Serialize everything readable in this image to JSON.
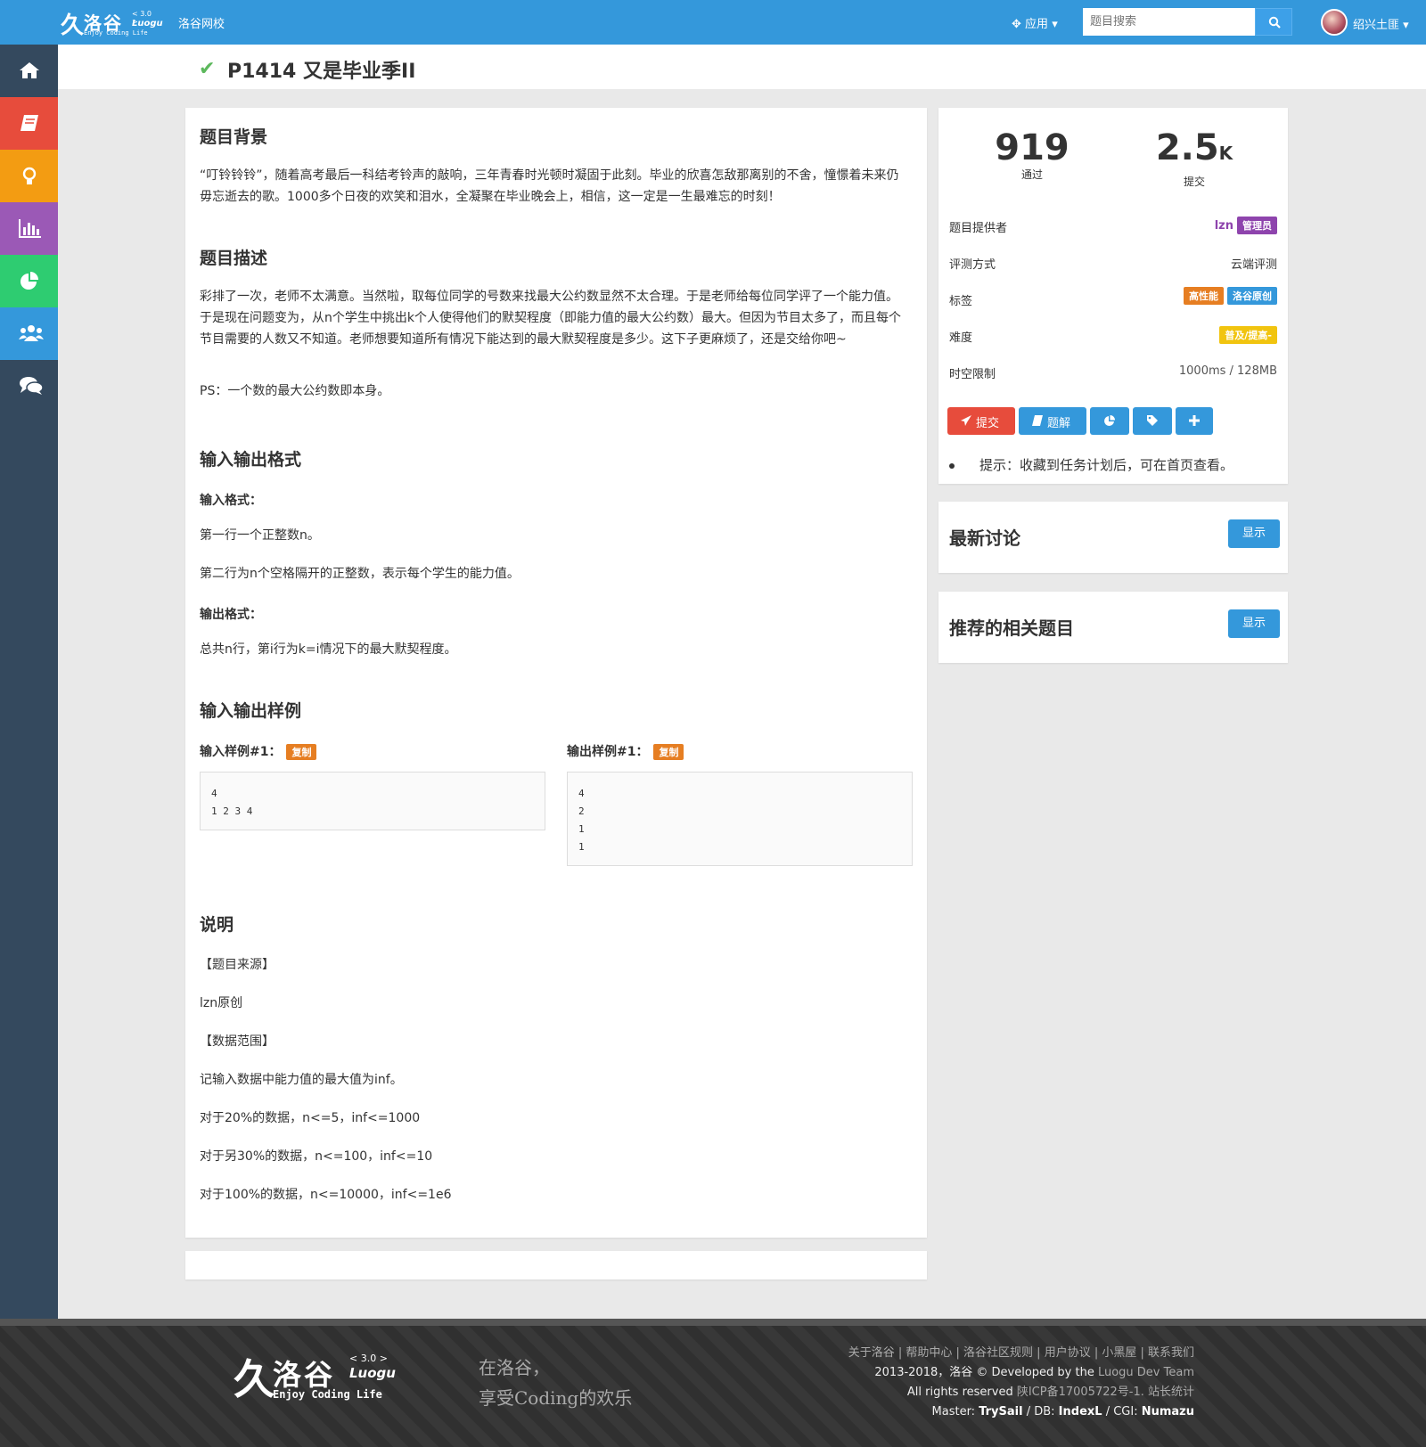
{
  "header": {
    "logo": {
      "name": "洛谷",
      "version": "< 3.0 >",
      "sub": "Luogu",
      "tagline": "Enjoy Coding Life"
    },
    "school_link": "洛谷网校",
    "apps_label": "应用",
    "search_placeholder": "题目搜索",
    "user_name": "绍兴土匪"
  },
  "sidebar": {
    "items": [
      {
        "icon": "home-icon",
        "color": "#34495e"
      },
      {
        "icon": "book-icon",
        "color": "#e74c3c"
      },
      {
        "icon": "lightbulb-icon",
        "color": "#f39c12"
      },
      {
        "icon": "bar-chart-icon",
        "color": "#9b59b6"
      },
      {
        "icon": "pie-chart-icon",
        "color": "#2ecc71"
      },
      {
        "icon": "users-icon",
        "color": "#3498db"
      },
      {
        "icon": "comments-icon",
        "color": "#34495e"
      }
    ]
  },
  "problem": {
    "title": "P1414 又是毕业季II",
    "background_h": "题目背景",
    "background_p": "“叮铃铃铃”，随着高考最后一科结考铃声的敲响，三年青春时光顿时凝固于此刻。毕业的欣喜怎敌那离别的不舍，憧憬着未来仍毋忘逝去的歌。1000多个日夜的欢笑和泪水，全凝聚在毕业晚会上，相信，这一定是一生最难忘的时刻！",
    "desc_h": "题目描述",
    "desc_p1": "彩排了一次，老师不太满意。当然啦，取每位同学的号数来找最大公约数显然不太合理。于是老师给每位同学评了一个能力值。于是现在问题变为，从n个学生中挑出k个人使得他们的默契程度（即能力值的最大公约数）最大。但因为节目太多了，而且每个节目需要的人数又不知道。老师想要知道所有情况下能达到的最大默契程度是多少。这下子更麻烦了，还是交给你吧~",
    "desc_p2": "PS：一个数的最大公约数即本身。",
    "io_h": "输入输出格式",
    "input_fmt_h": "输入格式：",
    "input_fmt_1": "第一行一个正整数n。",
    "input_fmt_2": "第二行为n个空格隔开的正整数，表示每个学生的能力值。",
    "output_fmt_h": "输出格式：",
    "output_fmt_1": "总共n行，第i行为k=i情况下的最大默契程度。",
    "sample_h": "输入输出样例",
    "sample_in_h": "输入样例#1：",
    "sample_out_h": "输出样例#1：",
    "copy_label": "复制",
    "sample_in": "4\n1 2 3 4",
    "sample_out": "4\n2\n1\n1",
    "note_h": "说明",
    "note_1": "【题目来源】",
    "note_2": "lzn原创",
    "note_3": "【数据范围】",
    "note_4": "记输入数据中能力值的最大值为inf。",
    "note_5": "对于20%的数据，n<=5，inf<=1000",
    "note_6": "对于另30%的数据，n<=100，inf<=10",
    "note_7": "对于100%的数据，n<=10000，inf<=1e6"
  },
  "info": {
    "passed": "919",
    "passed_label": "通过",
    "submitted": "2.5",
    "submitted_unit": "K",
    "submitted_label": "提交",
    "provider_label": "题目提供者",
    "provider": "lzn",
    "provider_badge": "管理员",
    "judge_label": "评测方式",
    "judge": "云端评测",
    "tags_label": "标签",
    "tag1": "高性能",
    "tag2": "洛谷原创",
    "difficulty_label": "难度",
    "difficulty": "普及/提高-",
    "limit_label": "时空限制",
    "limit": "1000ms / 128MB",
    "btn_submit": "提交",
    "btn_solution": "题解",
    "tip": "提示：收藏到任务计划后，可在首页查看。"
  },
  "discuss": {
    "title": "最新讨论",
    "show": "显示"
  },
  "related": {
    "title": "推荐的相关题目",
    "show": "显示"
  },
  "footer": {
    "slogan1": "在洛谷，",
    "slogan2": "享受Coding的欢乐",
    "links": "关于洛谷 | 帮助中心 | 洛谷社区规则 | 用户协议 | 小黑屋 | 联系我们",
    "copyright_pre": "2013-2018，洛谷 © Developed by the ",
    "copyright_team": "Luogu Dev Team",
    "rights_pre": "All rights reserved ",
    "rights_icp": "陕ICP备17005722号-1. 站长统计",
    "master_label": "Master: ",
    "master": "TrySail",
    "db_label": " / DB: ",
    "db": "IndexL",
    "cgi_label": " / CGI: ",
    "cgi": "Numazu"
  }
}
